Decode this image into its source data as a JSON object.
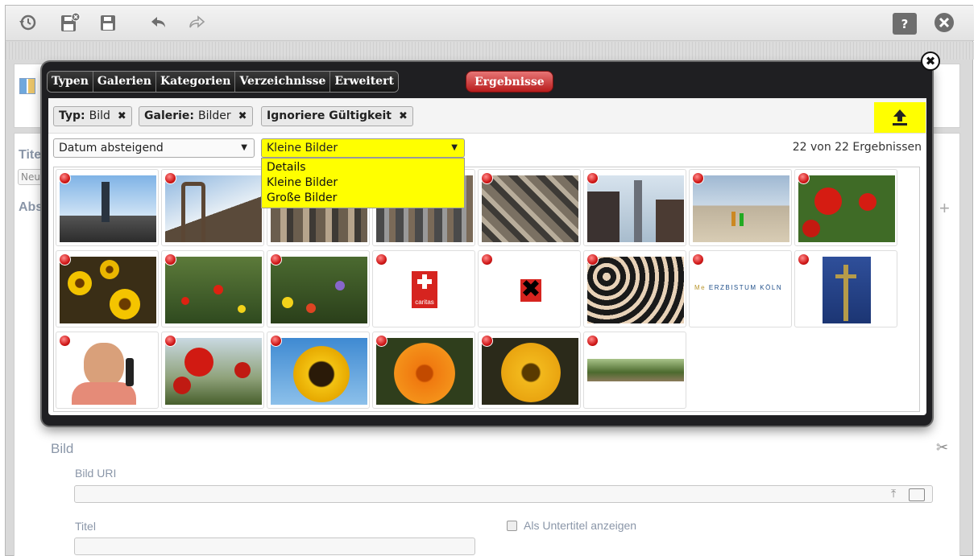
{
  "toolbar": {
    "left_icons": [
      "history-icon",
      "discard-save-icon",
      "save-icon",
      "undo-icon",
      "redo-icon"
    ],
    "right_icons": [
      "help-icon",
      "close-circle-icon"
    ]
  },
  "background_form": {
    "title_label_partial": "Tite",
    "title_value_partial": "Neu",
    "section_partial": "Abs",
    "section_image": "Bild",
    "image_uri_label": "Bild URI",
    "caption_title_label": "Titel",
    "show_as_subtitle_label": "Als Untertitel anzeigen"
  },
  "modal": {
    "tabs": [
      "Typen",
      "Galerien",
      "Kategorien",
      "Verzeichnisse",
      "Erweitert"
    ],
    "results_tab": "Ergebnisse",
    "filters": [
      {
        "key": "Typ:",
        "value": "Bild"
      },
      {
        "key": "Galerie:",
        "value": "Bilder"
      },
      {
        "key": "Ignoriere Gültigkeit",
        "value": ""
      }
    ],
    "sort": {
      "selected": "Datum absteigend"
    },
    "view": {
      "selected": "Kleine Bilder",
      "options": [
        "Details",
        "Kleine Bilder",
        "Große Bilder"
      ]
    },
    "result_count": "22 von 22 Ergebnissen",
    "highlight_color": "#ffff00",
    "results_color": "#cc2a2a",
    "thumbnails": [
      {
        "subject": "city-skyline"
      },
      {
        "subject": "brooklyn-bridge"
      },
      {
        "subject": "city-aerial"
      },
      {
        "subject": "street"
      },
      {
        "subject": "city-aerial-2"
      },
      {
        "subject": "chrysler-building"
      },
      {
        "subject": "beach-kite"
      },
      {
        "subject": "red-poppies"
      },
      {
        "subject": "yellow-flowers"
      },
      {
        "subject": "meadow-flowers"
      },
      {
        "subject": "wildflowers"
      },
      {
        "subject": "caritas-logo",
        "text": "caritas"
      },
      {
        "subject": "red-x"
      },
      {
        "subject": "choir"
      },
      {
        "subject": "erzbistum-logo",
        "text": "ERZBISTUM KÖLN"
      },
      {
        "subject": "church-tower"
      },
      {
        "subject": "man-on-phone"
      },
      {
        "subject": "poppies"
      },
      {
        "subject": "sunflower"
      },
      {
        "subject": "orange-flower"
      },
      {
        "subject": "yellow-marigold"
      },
      {
        "subject": "park-landscape"
      }
    ]
  }
}
